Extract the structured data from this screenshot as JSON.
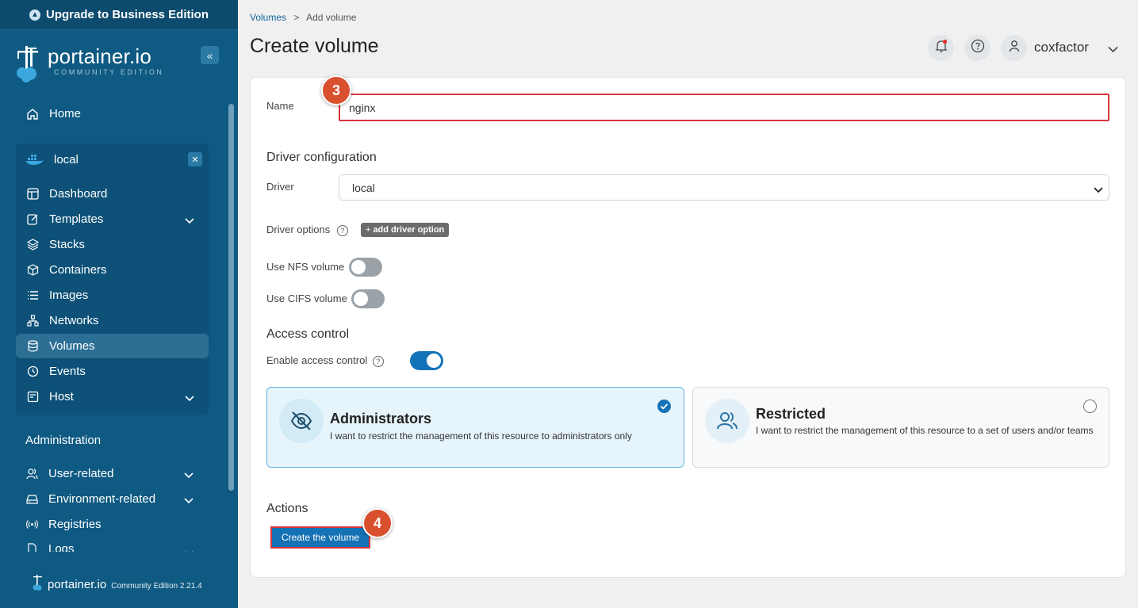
{
  "upgrade_label": "Upgrade to Business Edition",
  "logo": {
    "name": "portainer.io",
    "sub": "COMMUNITY EDITION"
  },
  "nav": {
    "home": "Home",
    "environment": "local",
    "items": [
      {
        "label": "Dashboard"
      },
      {
        "label": "Templates"
      },
      {
        "label": "Stacks"
      },
      {
        "label": "Containers"
      },
      {
        "label": "Images"
      },
      {
        "label": "Networks"
      },
      {
        "label": "Volumes"
      },
      {
        "label": "Events"
      },
      {
        "label": "Host"
      }
    ],
    "admin_title": "Administration",
    "admin_items": [
      {
        "label": "User-related"
      },
      {
        "label": "Environment-related"
      },
      {
        "label": "Registries"
      },
      {
        "label": "Logs"
      }
    ]
  },
  "footer": {
    "name": "portainer.io",
    "version": "Community Edition 2.21.4"
  },
  "breadcrumb": {
    "parent": "Volumes",
    "separator": ">",
    "current": "Add volume"
  },
  "page_title": "Create volume",
  "user": {
    "name": "coxfactor"
  },
  "form": {
    "name_label": "Name",
    "name_value": "nginx",
    "driver_section": "Driver configuration",
    "driver_label": "Driver",
    "driver_value": "local",
    "driver_options_label": "Driver options",
    "add_driver_option": "add driver option",
    "nfs_label": "Use NFS volume",
    "nfs_enabled": false,
    "cifs_label": "Use CIFS volume",
    "cifs_enabled": false,
    "access_section": "Access control",
    "access_label": "Enable access control",
    "access_enabled": true,
    "admins_title": "Administrators",
    "admins_desc": "I want to restrict the management of this resource to administrators only",
    "restricted_title": "Restricted",
    "restricted_desc": "I want to restrict the management of this resource to a set of users and/or teams",
    "actions_section": "Actions",
    "create_button": "Create the volume"
  },
  "badges": {
    "step3": "3",
    "step4": "4"
  },
  "colors": {
    "sidebar": "#0f5a82",
    "accent": "#1473b8",
    "badge": "#d8502e",
    "highlight": "#d9363e"
  }
}
